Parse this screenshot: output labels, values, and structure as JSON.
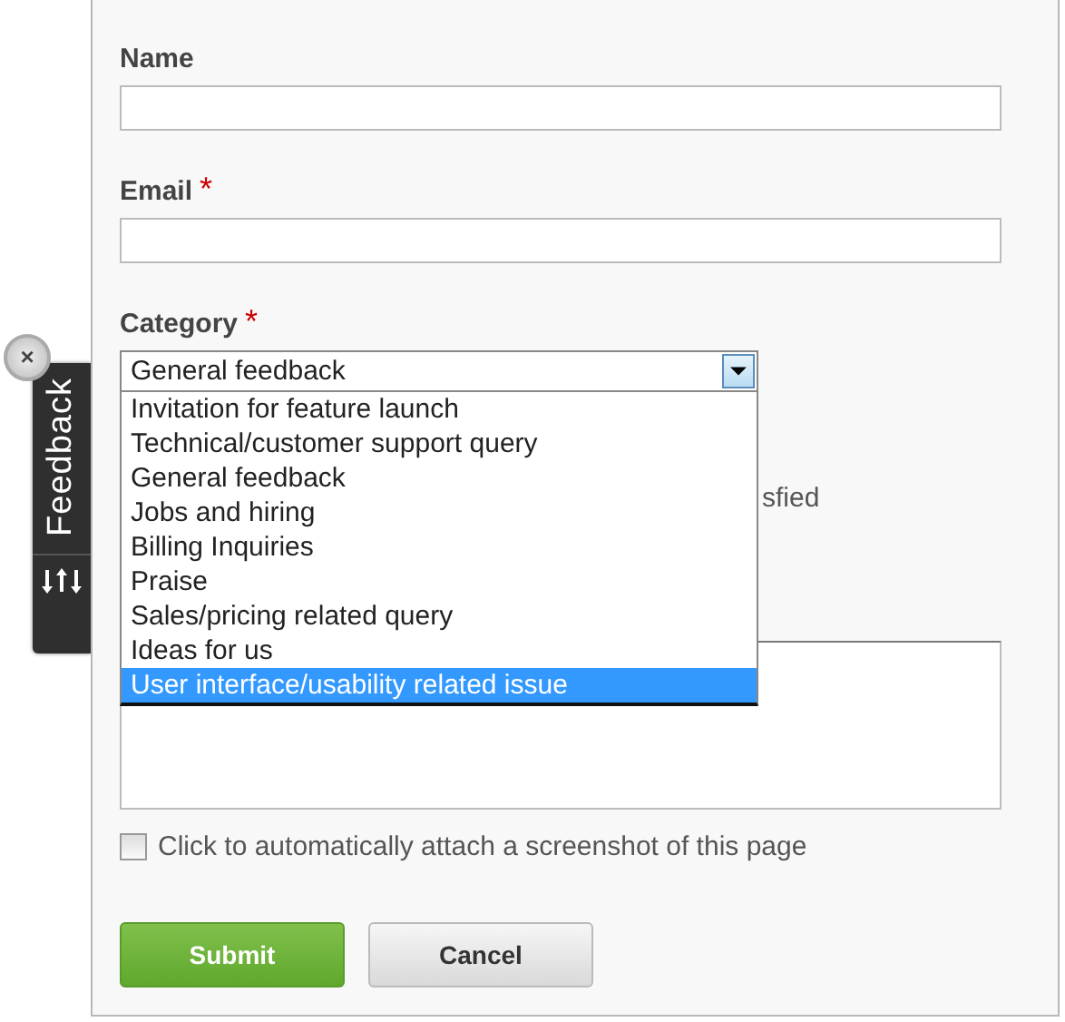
{
  "feedback_tab": {
    "label": "Feedback",
    "close": "×"
  },
  "fields": [
    {
      "label": "Name"
    },
    {
      "label": "Email",
      "required_mark": "*"
    }
  ],
  "category": {
    "label": "Category",
    "required_mark": "*",
    "value": "General feedback",
    "expanded": true,
    "options": [
      {
        "label": "Invitation for feature launch",
        "highlighted": false
      },
      {
        "label": "Technical/customer support query",
        "highlighted": false
      },
      {
        "label": "General feedback",
        "highlighted": false
      },
      {
        "label": "Jobs and hiring",
        "highlighted": false
      },
      {
        "label": "Billing Inquiries",
        "highlighted": false
      },
      {
        "label": "Praise",
        "highlighted": false
      },
      {
        "label": "Sales/pricing related query",
        "highlighted": false
      },
      {
        "label": "Ideas for us",
        "highlighted": false
      },
      {
        "label": "User interface/usability related issue",
        "highlighted": true
      }
    ]
  },
  "rating_fragment": "sfied",
  "screenshot_checkbox": {
    "label": "Click to automatically attach a screenshot of this page",
    "checked": false
  },
  "buttons": [
    {
      "label": "Submit",
      "kind": "primary"
    },
    {
      "label": "Cancel",
      "kind": "secondary"
    }
  ]
}
